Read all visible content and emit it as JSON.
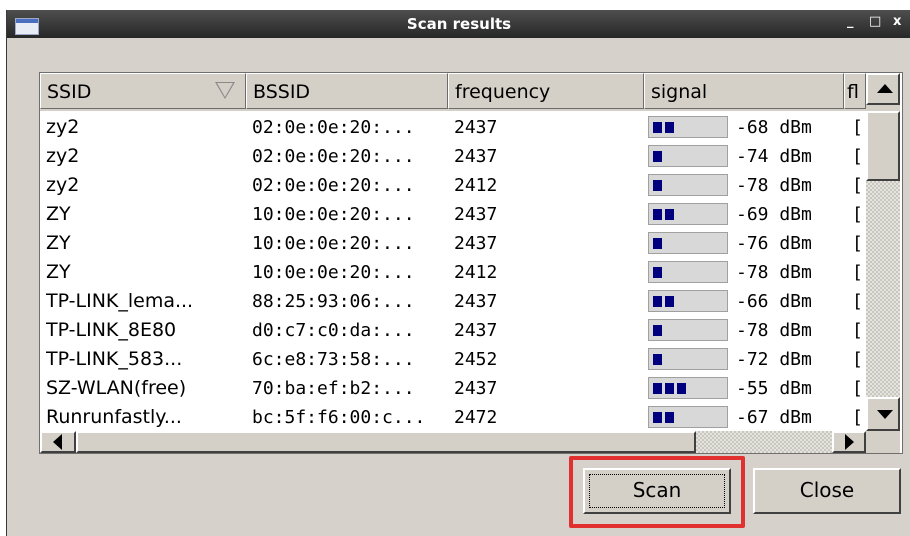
{
  "window": {
    "title": "Scan results",
    "minimize_glyph": "_",
    "maximize_glyph": "□",
    "close_glyph": "x"
  },
  "table": {
    "columns": [
      "SSID",
      "BSSID",
      "frequency",
      "signal",
      "fl"
    ],
    "rows": [
      {
        "ssid": "zy2",
        "bssid": "02:0e:0e:20:...",
        "frequency": "2437",
        "bars": 2,
        "signal": "-68 dBm",
        "flags": "["
      },
      {
        "ssid": "zy2",
        "bssid": "02:0e:0e:20:...",
        "frequency": "2437",
        "bars": 1,
        "signal": "-74 dBm",
        "flags": "["
      },
      {
        "ssid": "zy2",
        "bssid": "02:0e:0e:20:...",
        "frequency": "2412",
        "bars": 1,
        "signal": "-78 dBm",
        "flags": "["
      },
      {
        "ssid": "ZY",
        "bssid": "10:0e:0e:20:...",
        "frequency": "2437",
        "bars": 2,
        "signal": "-69 dBm",
        "flags": "["
      },
      {
        "ssid": "ZY",
        "bssid": "10:0e:0e:20:...",
        "frequency": "2437",
        "bars": 1,
        "signal": "-76 dBm",
        "flags": "["
      },
      {
        "ssid": "ZY",
        "bssid": "10:0e:0e:20:...",
        "frequency": "2412",
        "bars": 1,
        "signal": "-78 dBm",
        "flags": "["
      },
      {
        "ssid": "TP-LINK_lema...",
        "bssid": "88:25:93:06:...",
        "frequency": "2437",
        "bars": 2,
        "signal": "-66 dBm",
        "flags": "["
      },
      {
        "ssid": "TP-LINK_8E80",
        "bssid": "d0:c7:c0:da:...",
        "frequency": "2437",
        "bars": 1,
        "signal": "-78 dBm",
        "flags": "["
      },
      {
        "ssid": "TP-LINK_583...",
        "bssid": "6c:e8:73:58:...",
        "frequency": "2452",
        "bars": 1,
        "signal": "-72 dBm",
        "flags": "["
      },
      {
        "ssid": "SZ-WLAN(free)",
        "bssid": "70:ba:ef:b2:...",
        "frequency": "2437",
        "bars": 3,
        "signal": "-55 dBm",
        "flags": "["
      },
      {
        "ssid": "Runrunfastly...",
        "bssid": "bc:5f:f6:00:c...",
        "frequency": "2472",
        "bars": 2,
        "signal": "-67 dBm",
        "flags": "["
      }
    ]
  },
  "buttons": {
    "scan": "Scan",
    "close": "Close"
  },
  "colors": {
    "signal_bar": "#00007f",
    "highlight": "#e03030"
  }
}
